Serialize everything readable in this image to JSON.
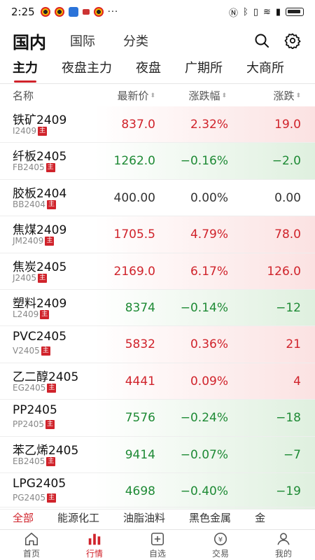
{
  "status_bar": {
    "time": "2:25",
    "dots": "···"
  },
  "top_nav": {
    "main": "国内",
    "tabs": [
      "国际",
      "分类"
    ]
  },
  "sub_tabs": [
    "主力",
    "夜盘主力",
    "夜盘",
    "广期所",
    "大商所"
  ],
  "columns": {
    "name": "名称",
    "price": "最新价",
    "pct": "涨跌幅",
    "chg": "涨跌"
  },
  "badge": "主",
  "rows": [
    {
      "name": "铁矿2409",
      "code": "I2409",
      "price": "837.0",
      "pct": "2.32%",
      "chg": "19.0",
      "dir": "up"
    },
    {
      "name": "纤板2405",
      "code": "FB2405",
      "price": "1262.0",
      "pct": "−0.16%",
      "chg": "−2.0",
      "dir": "down"
    },
    {
      "name": "胶板2404",
      "code": "BB2404",
      "price": "400.00",
      "pct": "0.00%",
      "chg": "0.00",
      "dir": "flat"
    },
    {
      "name": "焦煤2409",
      "code": "JM2409",
      "price": "1705.5",
      "pct": "4.79%",
      "chg": "78.0",
      "dir": "up"
    },
    {
      "name": "焦炭2405",
      "code": "J2405",
      "price": "2169.0",
      "pct": "6.17%",
      "chg": "126.0",
      "dir": "up"
    },
    {
      "name": "塑料2409",
      "code": "L2409",
      "price": "8374",
      "pct": "−0.14%",
      "chg": "−12",
      "dir": "down"
    },
    {
      "name": "PVC2405",
      "code": "V2405",
      "price": "5832",
      "pct": "0.36%",
      "chg": "21",
      "dir": "up"
    },
    {
      "name": "乙二醇2405",
      "code": "EG2405",
      "price": "4441",
      "pct": "0.09%",
      "chg": "4",
      "dir": "up"
    },
    {
      "name": "PP2405",
      "code": "PP2405",
      "price": "7576",
      "pct": "−0.24%",
      "chg": "−18",
      "dir": "down"
    },
    {
      "name": "苯乙烯2405",
      "code": "EB2405",
      "price": "9414",
      "pct": "−0.07%",
      "chg": "−7",
      "dir": "down"
    },
    {
      "name": "LPG2405",
      "code": "PG2405",
      "price": "4698",
      "pct": "−0.40%",
      "chg": "−19",
      "dir": "down"
    }
  ],
  "categories": [
    "全部",
    "能源化工",
    "油脂油料",
    "黑色金属",
    "金"
  ],
  "bottom_nav": [
    "首页",
    "行情",
    "自选",
    "交易",
    "我的"
  ],
  "colors": {
    "up": "#d0232b",
    "down": "#1e8a35",
    "accent": "#d0232b"
  }
}
